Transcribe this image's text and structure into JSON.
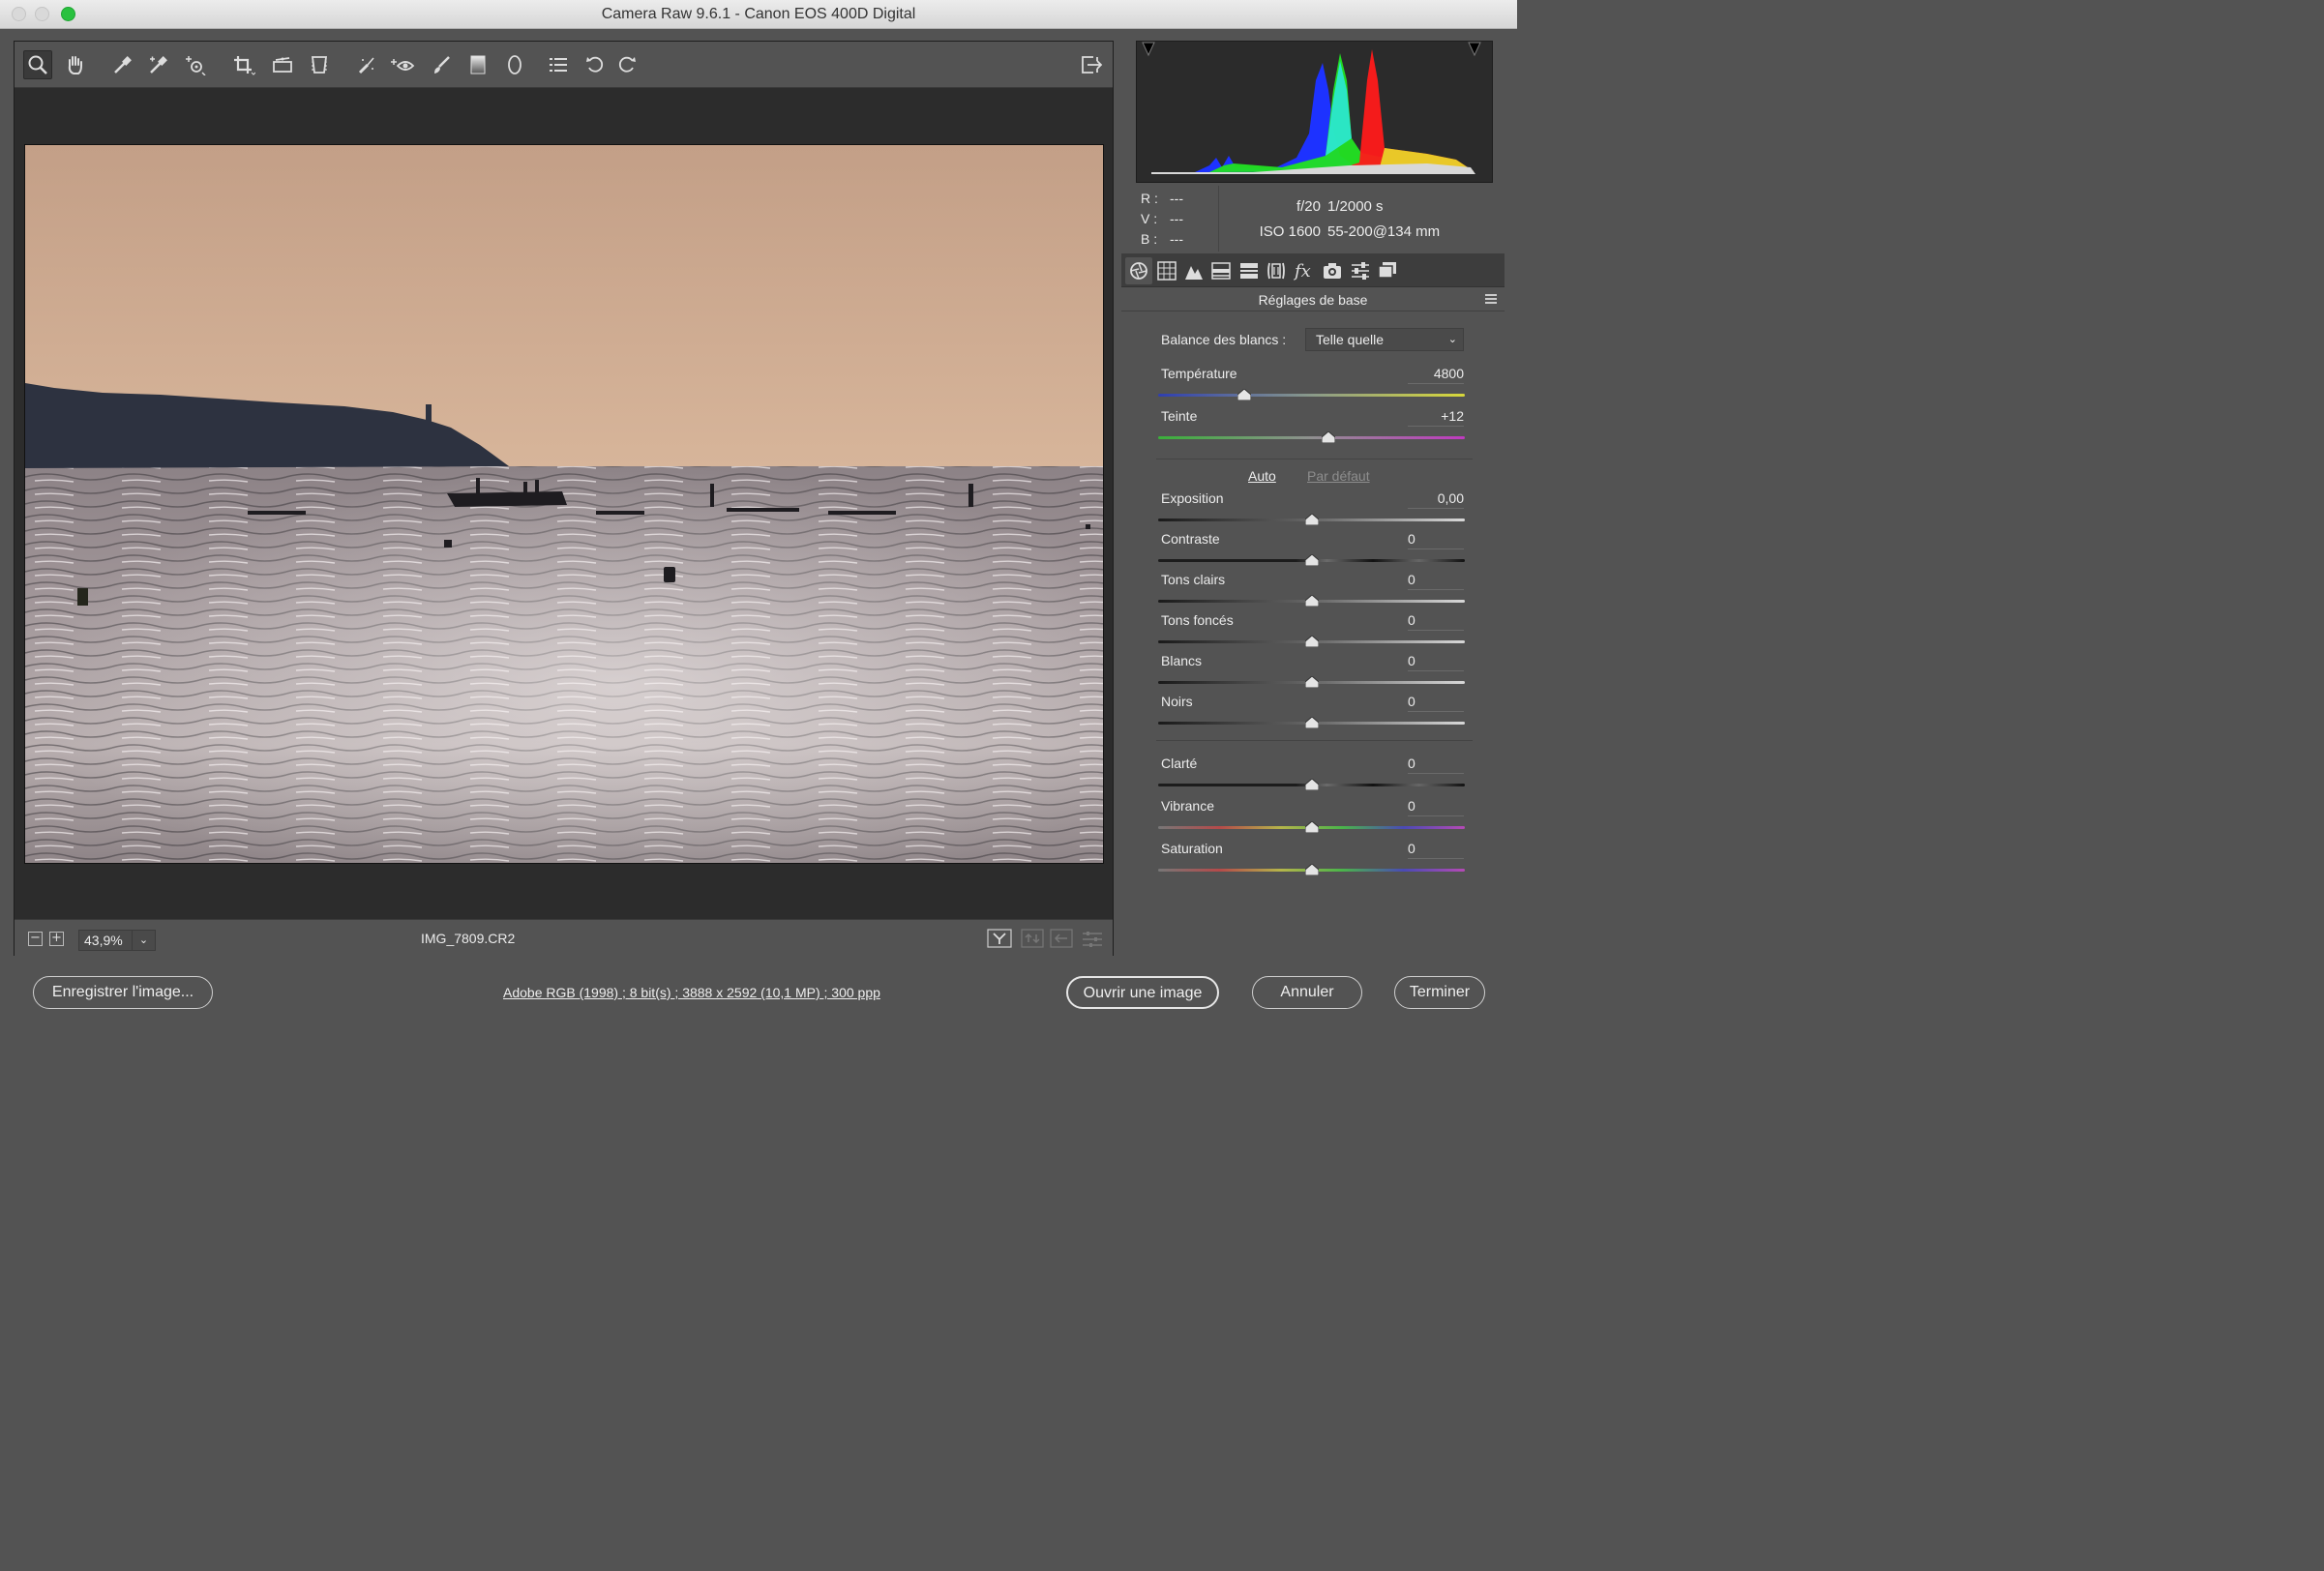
{
  "window": {
    "title": "Camera Raw 9.6.1  -  Canon EOS 400D Digital"
  },
  "toolbar": {
    "tools": [
      "zoom-tool",
      "hand-tool",
      "white-balance-tool",
      "color-sampler-tool",
      "targeted-adjustment-tool",
      "crop-tool",
      "straighten-tool",
      "transform-tool",
      "spot-removal-tool",
      "red-eye-tool",
      "adjustment-brush-tool",
      "graduated-filter-tool",
      "radial-filter-tool",
      "preferences-tool",
      "rotate-left-tool",
      "rotate-right-tool"
    ],
    "fullscreen": "fullscreen-toggle-icon"
  },
  "preview": {
    "zoom_value": "43,9%",
    "filename": "IMG_7809.CR2"
  },
  "readout": {
    "r_label": "R :",
    "v_label": "V :",
    "b_label": "B :",
    "r_value": "---",
    "v_value": "---",
    "b_value": "---"
  },
  "exif": {
    "aperture": "f/20",
    "shutter": "1/2000 s",
    "iso": "ISO 1600",
    "lens": "55-200@134 mm"
  },
  "panel": {
    "title": "Réglages de base",
    "wb_label": "Balance des blancs :",
    "wb_value": "Telle quelle",
    "auto": "Auto",
    "default": "Par défaut",
    "sliders": [
      {
        "label": "Température",
        "value": "4800",
        "pos": 0.28
      },
      {
        "label": "Teinte",
        "value": "+12",
        "pos": 0.555
      },
      {
        "label": "Exposition",
        "value": "0,00",
        "pos": 0.5
      },
      {
        "label": "Contraste",
        "value": "0",
        "pos": 0.5
      },
      {
        "label": "Tons clairs",
        "value": "0",
        "pos": 0.5
      },
      {
        "label": "Tons foncés",
        "value": "0",
        "pos": 0.5
      },
      {
        "label": "Blancs",
        "value": "0",
        "pos": 0.5
      },
      {
        "label": "Noirs",
        "value": "0",
        "pos": 0.5
      },
      {
        "label": "Clarté",
        "value": "0",
        "pos": 0.5
      },
      {
        "label": "Vibrance",
        "value": "0",
        "pos": 0.5
      },
      {
        "label": "Saturation",
        "value": "0",
        "pos": 0.5
      }
    ]
  },
  "footer": {
    "save": "Enregistrer l'image...",
    "info": "Adobe RGB (1998) ; 8 bit(s) ; 3888 x 2592 (10,1 MP) ; 300 ppp",
    "open": "Ouvrir une image",
    "cancel": "Annuler",
    "done": "Terminer"
  },
  "colors": {
    "window_bg": "#535353",
    "canvas_bg": "#2c2c2c",
    "temp_low": "#2f3fb0",
    "temp_high": "#d8d83a",
    "tint_low": "#3ab03a",
    "tint_high": "#c03ac0"
  }
}
